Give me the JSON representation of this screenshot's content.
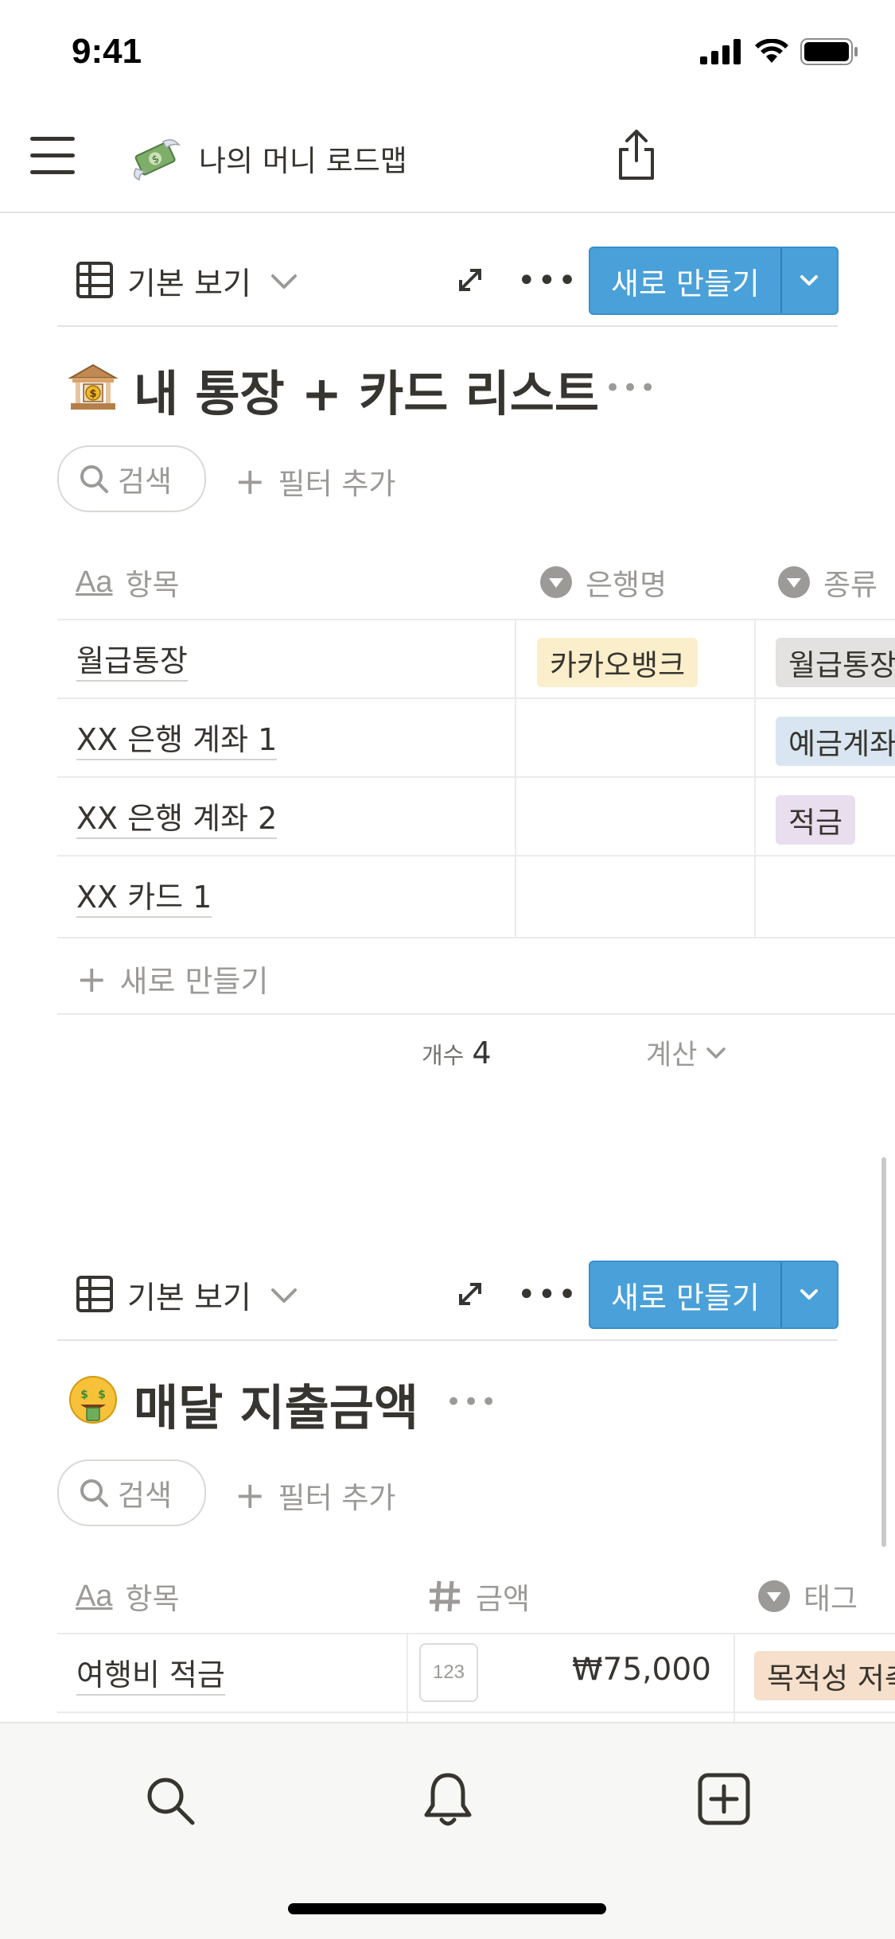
{
  "status_bar": {
    "time": "9:41"
  },
  "nav": {
    "page_title": "나의 머니 로드맵",
    "page_icon": "money-with-wings-icon"
  },
  "toolbar": {
    "view_label": "기본 보기",
    "new_label": "새로 만들기"
  },
  "db1": {
    "title": "내 통장 + 카드 리스트",
    "icon": "bank-icon",
    "search_label": "검색",
    "filter_label": "필터 추가",
    "columns": [
      {
        "label": "항목",
        "icon": "title-aa-icon"
      },
      {
        "label": "은행명",
        "icon": "select-icon"
      },
      {
        "label": "종류",
        "icon": "select-icon"
      }
    ],
    "rows": [
      {
        "name": "월급통장",
        "bank": "카카오뱅크",
        "type": "월급통장"
      },
      {
        "name": "XX 은행 계좌 1",
        "bank": "",
        "type": "예금계좌"
      },
      {
        "name": "XX 은행 계좌 2",
        "bank": "",
        "type": "적금"
      },
      {
        "name": "XX 카드 1",
        "bank": "",
        "type": ""
      }
    ],
    "tag_colors": {
      "kakao": "#fbeecb",
      "salary": "#e3e2e0",
      "deposit": "#d9e6f1",
      "savings": "#e8deee"
    },
    "new_row_label": "새로 만들기",
    "count_label": "개수",
    "count_value": "4",
    "calc_label": "계산"
  },
  "db2": {
    "title": "매달 지출금액",
    "icon": "money-mouth-face-icon",
    "search_label": "검색",
    "filter_label": "필터 추가",
    "columns": [
      {
        "label": "항목",
        "icon": "title-aa-icon"
      },
      {
        "label": "금액",
        "icon": "number-hash-icon"
      },
      {
        "label": "태그",
        "icon": "select-icon"
      }
    ],
    "rows": [
      {
        "name": "여행비 적금",
        "badge": "123",
        "amount": "₩75,000",
        "tag": "목적성 저축"
      }
    ],
    "tag_colors": {
      "purpose": "#f6dfcb"
    }
  },
  "bottom_nav": [
    "search-icon",
    "bell-icon",
    "add-page-icon"
  ]
}
